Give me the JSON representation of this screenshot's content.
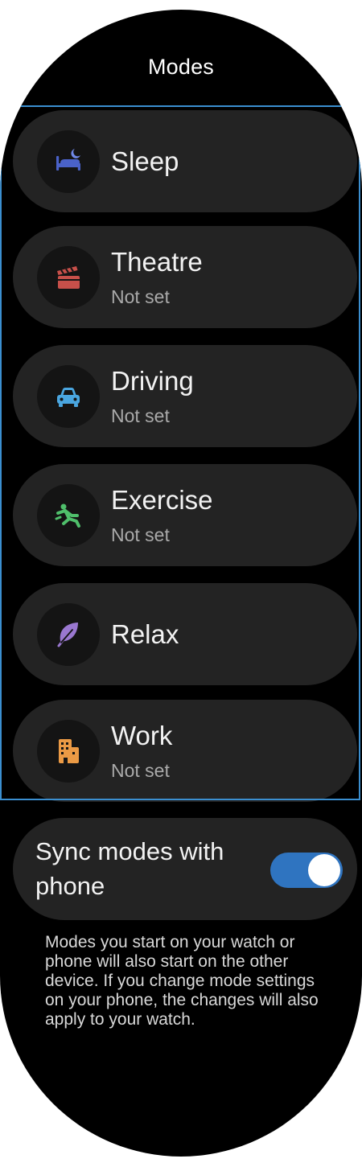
{
  "header": {
    "title": "Modes"
  },
  "modes": [
    {
      "label": "Sleep",
      "status": "",
      "icon": "bed-moon-icon",
      "color": "#4a62c9"
    },
    {
      "label": "Theatre",
      "status": "Not set",
      "icon": "clapperboard-icon",
      "color": "#c8504a"
    },
    {
      "label": "Driving",
      "status": "Not set",
      "icon": "car-icon",
      "color": "#4aa6e0"
    },
    {
      "label": "Exercise",
      "status": "Not set",
      "icon": "running-person-icon",
      "color": "#4fbf6b"
    },
    {
      "label": "Relax",
      "status": "",
      "icon": "leaf-icon",
      "color": "#9a78d0"
    },
    {
      "label": "Work",
      "status": "Not set",
      "icon": "building-icon",
      "color": "#eb9a45"
    }
  ],
  "sync": {
    "label": "Sync modes with phone",
    "enabled": true,
    "toggle_color": "#2f74c0"
  },
  "description": "Modes you start on your watch or phone will also start on the other device. If you change mode settings on your phone, the changes will also apply to your watch."
}
